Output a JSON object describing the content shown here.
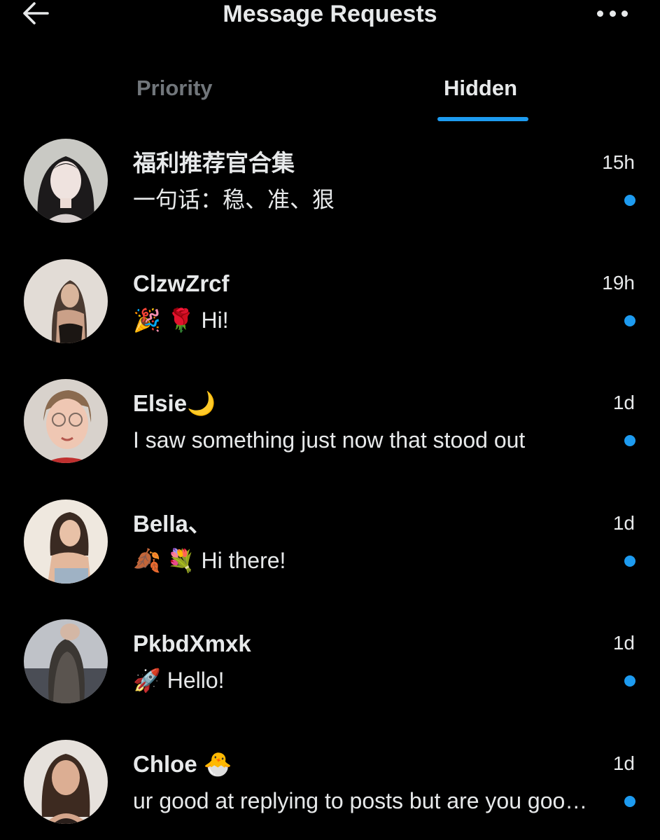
{
  "header": {
    "title": "Message Requests",
    "back_icon": "arrow-left-icon",
    "more_icon": "more-horizontal-icon"
  },
  "tabs": [
    {
      "label": "Priority",
      "active": false
    },
    {
      "label": "Hidden",
      "active": true
    }
  ],
  "colors": {
    "background": "#000000",
    "text_primary": "#e7e9ea",
    "text_secondary": "#71767b",
    "accent": "#1d9bf0"
  },
  "conversations": [
    {
      "name": "福利推荐官合集",
      "time": "15h",
      "preview": "一句话：稳、准、狠",
      "unread": true
    },
    {
      "name": "ClzwZrcf",
      "time": "19h",
      "preview": "🎉 🌹 Hi!",
      "unread": true
    },
    {
      "name": "Elsie🌙",
      "time": "1d",
      "preview": "I saw something just now that stood out",
      "unread": true
    },
    {
      "name": "Bella、",
      "time": "1d",
      "preview": "🍂 💐 Hi there!",
      "unread": true
    },
    {
      "name": "PkbdXmxk",
      "time": "1d",
      "preview": "🚀 Hello!",
      "unread": true
    },
    {
      "name": "Chloe 🐣",
      "time": "1d",
      "preview": "ur good at replying to posts but are you goo…",
      "unread": true
    }
  ]
}
